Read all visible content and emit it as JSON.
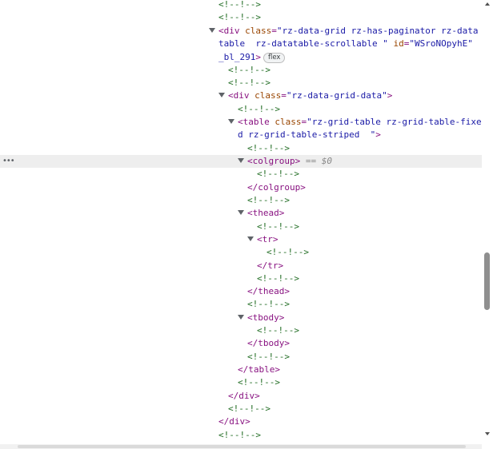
{
  "comment": "<!--!-->",
  "root_div": {
    "open_start": "<div",
    "class_attr": "class",
    "class_line1": "\"rz-data-grid rz-has-paginator rz-data",
    "class_line2": "table  rz-datatable-scrollable \"",
    "id_attr": "id",
    "id_line1": "\"WSroNOpyhE\"",
    "id_line2": "_bl_291",
    "close_bracket": ">",
    "badge": "flex",
    "close": "</div>"
  },
  "data_div": {
    "open_start": "<div",
    "class_attr": "class",
    "class_value": "\"rz-data-grid-data\"",
    "close_bracket": ">",
    "close": "</div>"
  },
  "table": {
    "open_start": "<table",
    "class_attr": "class",
    "class_line1": "\"rz-grid-table rz-grid-table-fixe",
    "class_line2": "d rz-grid-table-striped  \"",
    "close_bracket": ">",
    "close": "</table>"
  },
  "colgroup": {
    "open": "<colgroup>",
    "selected_ref": "== $0",
    "close": "</colgroup>"
  },
  "thead": {
    "open": "<thead>",
    "close": "</thead>"
  },
  "tr": {
    "open": "<tr>",
    "close": "</tr>"
  },
  "tbody": {
    "open": "<tbody>",
    "close": "</tbody>"
  },
  "row_menu": "•••",
  "colors": {
    "comment": "#236e25",
    "tag": "#881280",
    "attribute": "#994500",
    "value": "#1a1aa6",
    "selected_row": "#eeeeee"
  }
}
